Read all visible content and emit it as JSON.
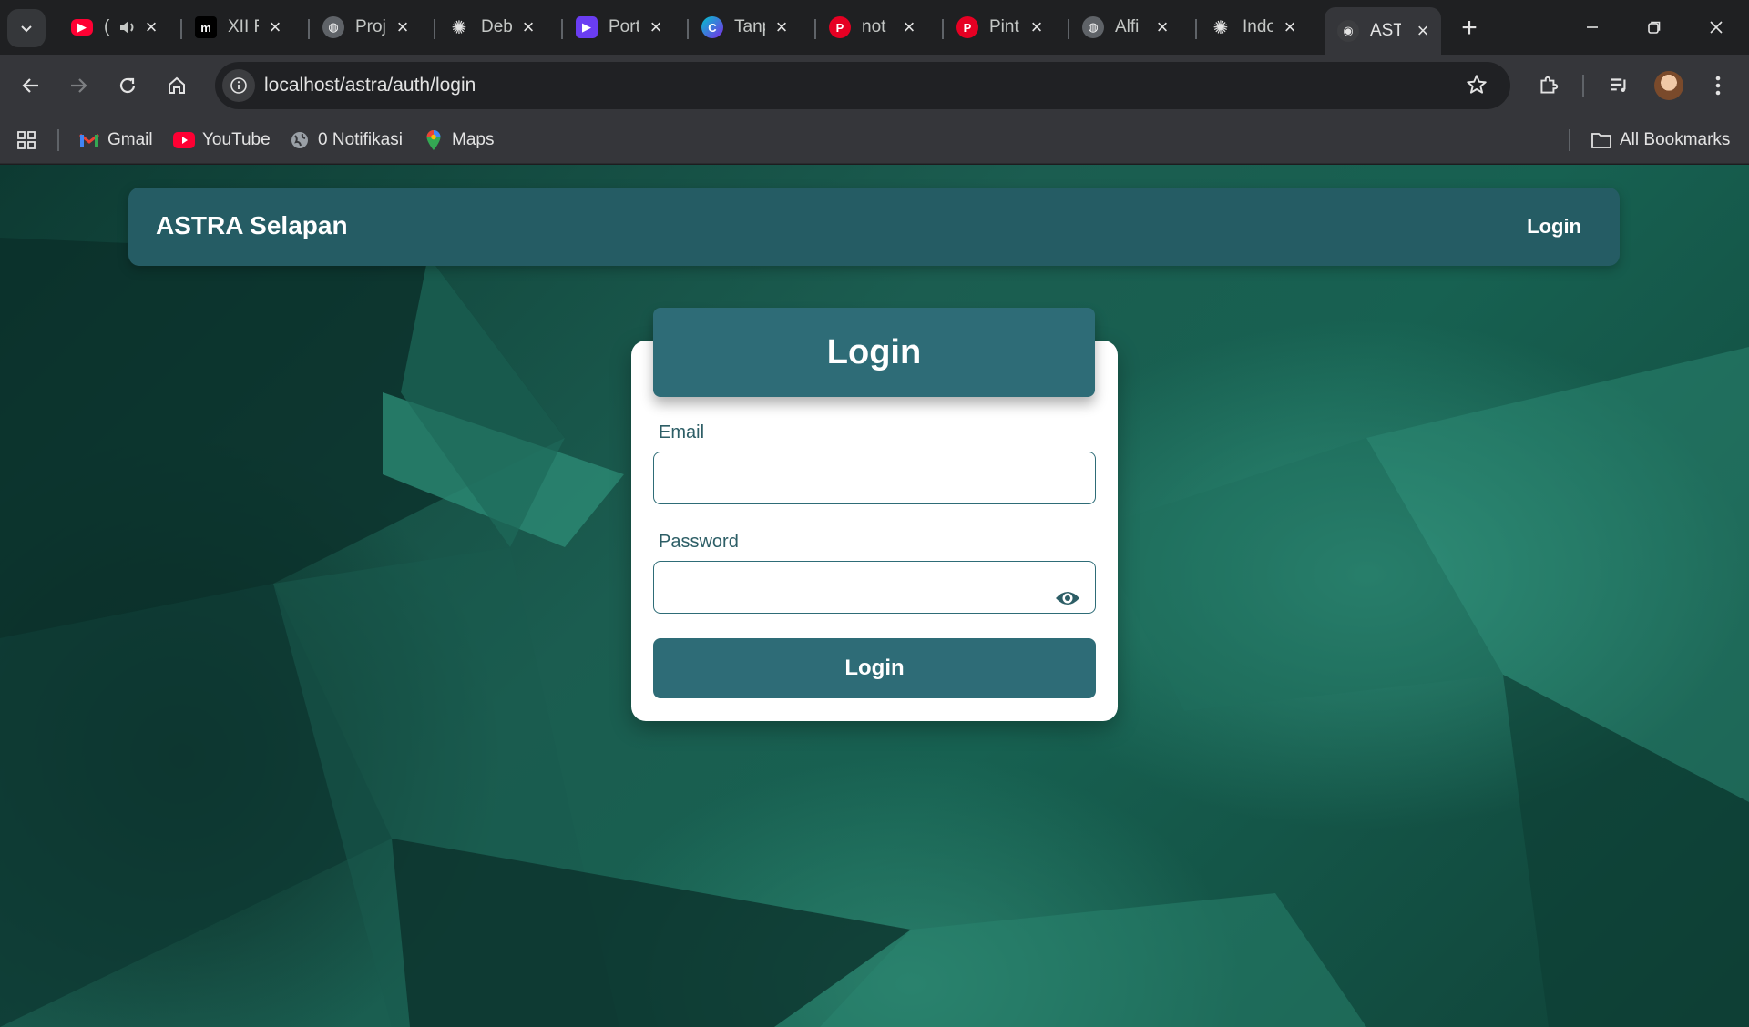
{
  "browser": {
    "tabs": [
      {
        "title": "(",
        "icon": "youtube-icon",
        "audio": true
      },
      {
        "title": "XII F",
        "icon": "m-logo-icon"
      },
      {
        "title": "Proj",
        "icon": "globe-icon"
      },
      {
        "title": "Deb",
        "icon": "openai-icon"
      },
      {
        "title": "Port",
        "icon": "video-icon"
      },
      {
        "title": "Tanp",
        "icon": "canva-icon"
      },
      {
        "title": "not",
        "icon": "pinterest-icon"
      },
      {
        "title": "Pint",
        "icon": "pinterest-icon"
      },
      {
        "title": "Alfi",
        "icon": "globe-icon"
      },
      {
        "title": "Indo",
        "icon": "openai-icon"
      },
      {
        "title": "AST",
        "icon": "site-favicon",
        "active": true
      }
    ],
    "address_url": "localhost/astra/auth/login",
    "bookmarks": [
      {
        "label": "Gmail",
        "icon": "gmail-icon"
      },
      {
        "label": "YouTube",
        "icon": "youtube-icon"
      },
      {
        "label": "0 Notifikasi",
        "icon": "globe-icon"
      },
      {
        "label": "Maps",
        "icon": "maps-icon"
      }
    ],
    "all_bookmarks_label": "All Bookmarks"
  },
  "site": {
    "brand": "ASTRA Selapan",
    "nav_login": "Login"
  },
  "login_form": {
    "title": "Login",
    "email_label": "Email",
    "email_value": "",
    "password_label": "Password",
    "password_value": "",
    "submit_label": "Login"
  },
  "colors": {
    "primary": "#2e6c77",
    "navbar": "#255c64",
    "background": "#176151"
  }
}
